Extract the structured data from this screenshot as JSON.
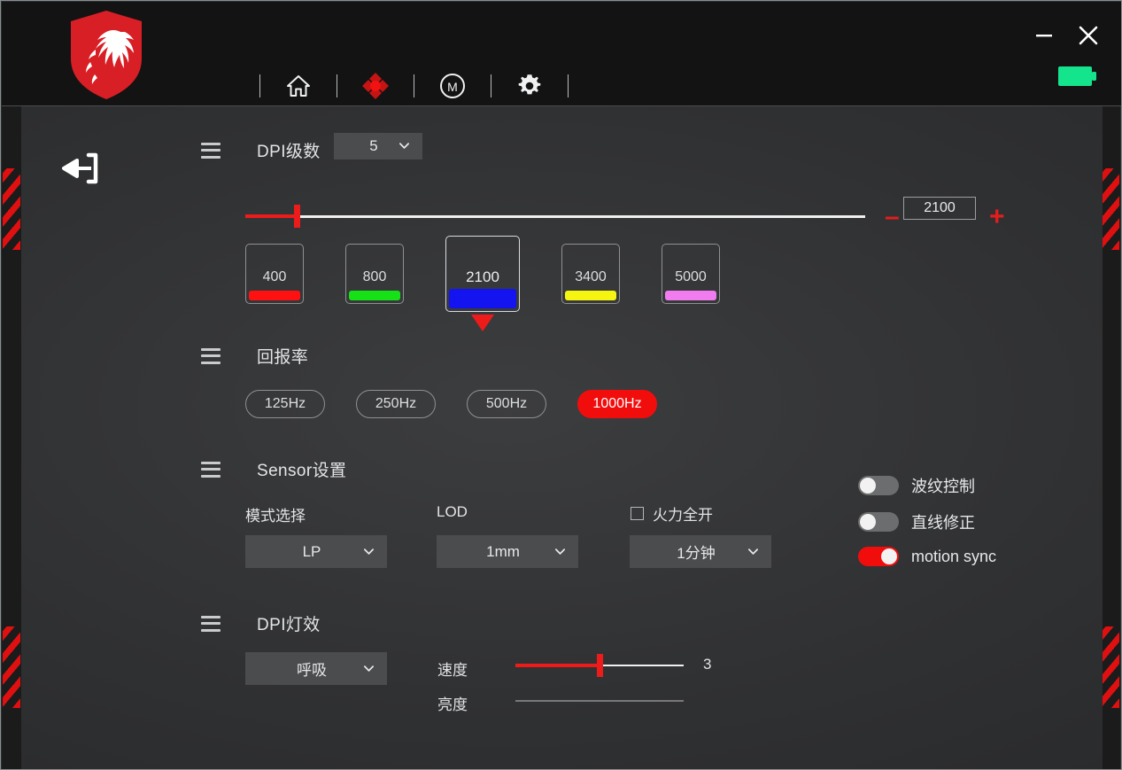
{
  "window": {
    "minimize_label": "–",
    "close_label": "✕",
    "battery_name": "battery-full"
  },
  "header": {
    "logo_name": "msi-dragon-logo",
    "nav": [
      {
        "name": "home",
        "label": "home-icon",
        "active": false
      },
      {
        "name": "sensor",
        "label": "dpi-sensor-icon",
        "active": true
      },
      {
        "name": "macro",
        "label": "macro-icon",
        "active": false
      },
      {
        "name": "settings",
        "label": "gear-icon",
        "active": false
      }
    ]
  },
  "sidebar": {
    "back_label": "back-icon"
  },
  "dpi_section": {
    "title": "DPI级数",
    "stage_count": "5",
    "slider": {
      "value": "2100",
      "minus_label": "–",
      "plus_label": "+",
      "position_percent": 8
    },
    "stages": [
      {
        "value": "400",
        "color": "#ff1111",
        "selected": false
      },
      {
        "value": "800",
        "color": "#16e016",
        "selected": false
      },
      {
        "value": "2100",
        "color": "#1414f0",
        "selected": true
      },
      {
        "value": "3400",
        "color": "#f5f511",
        "selected": false
      },
      {
        "value": "5000",
        "color": "#f07cf0",
        "selected": false
      }
    ]
  },
  "polling_section": {
    "title": "回报率",
    "options": [
      {
        "label": "125Hz",
        "selected": false
      },
      {
        "label": "250Hz",
        "selected": false
      },
      {
        "label": "500Hz",
        "selected": false
      },
      {
        "label": "1000Hz",
        "selected": true
      }
    ]
  },
  "sensor_section": {
    "title": "Sensor设置",
    "mode": {
      "label": "模式选择",
      "value": "LP"
    },
    "lod": {
      "label": "LOD",
      "value": "1mm"
    },
    "full_power": {
      "label": "火力全开",
      "checked": false,
      "value": "1分钟"
    },
    "toggles": [
      {
        "label": "波纹控制",
        "on": false
      },
      {
        "label": "直线修正",
        "on": false
      },
      {
        "label": "motion sync",
        "on": true
      }
    ]
  },
  "led_section": {
    "title": "DPI灯效",
    "effect": "呼吸",
    "speed": {
      "label": "速度",
      "value": "3",
      "percent": 50
    },
    "brightness": {
      "label": "亮度",
      "percent": 0,
      "disabled": true
    }
  },
  "colors": {
    "accent_red": "#f20d0d",
    "battery_green": "#14e58c",
    "panel_dark": "#131313"
  }
}
